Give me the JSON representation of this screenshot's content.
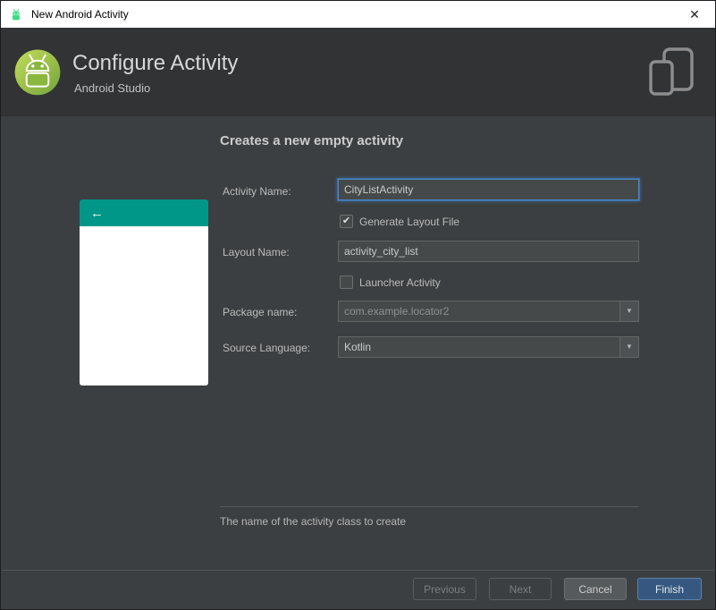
{
  "window": {
    "title": "New Android Activity"
  },
  "icons": {
    "close": "✕",
    "back_arrow": "←",
    "dropdown": "▼",
    "check": "✔"
  },
  "header": {
    "title": "Configure Activity",
    "subtitle": "Android Studio"
  },
  "content": {
    "heading": "Creates a new empty activity",
    "hint": "The name of the activity class to create"
  },
  "form": {
    "activity_name": {
      "label": "Activity Name:",
      "value": "CityListActivity"
    },
    "generate_layout": {
      "label": "Generate Layout File",
      "checked": "true"
    },
    "layout_name": {
      "label": "Layout Name:",
      "value": "activity_city_list"
    },
    "launcher_activity": {
      "label": "Launcher Activity",
      "checked": "false"
    },
    "package_name": {
      "label": "Package name:",
      "value": "com.example.locator2"
    },
    "source_language": {
      "label": "Source Language:",
      "value": "Kotlin"
    }
  },
  "buttons": {
    "previous": "Previous",
    "next": "Next",
    "cancel": "Cancel",
    "finish": "Finish"
  },
  "colors": {
    "teal_header": "#009688",
    "focus_border": "#4a88c7",
    "finish_bg": "#365880"
  }
}
